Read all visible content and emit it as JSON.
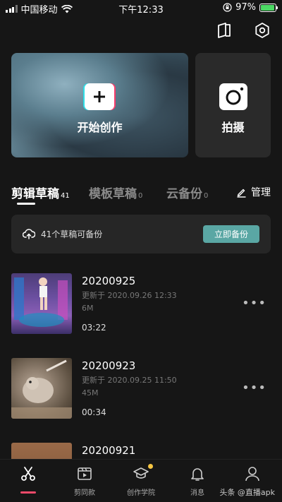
{
  "status_bar": {
    "carrier": "中国移动",
    "time": "下午12:33",
    "battery_percent": "97%",
    "battery_level": 0.97,
    "battery_color": "#4cd964"
  },
  "top_icons": [
    "book-icon",
    "settings-hexagon-icon"
  ],
  "create_card": {
    "label": "开始创作",
    "icon": "plus-icon"
  },
  "shoot_card": {
    "label": "拍摄",
    "icon": "camera-icon"
  },
  "tabs": [
    {
      "label": "剪辑草稿",
      "count": "41",
      "active": true
    },
    {
      "label": "模板草稿",
      "count": "0",
      "active": false
    },
    {
      "label": "云备份",
      "count": "0",
      "active": false
    }
  ],
  "manage": {
    "label": "管理",
    "icon": "edit-icon"
  },
  "backup": {
    "text": "41个草稿可备份",
    "button": "立即备份",
    "button_color": "#5aa7a4"
  },
  "drafts": [
    {
      "title": "20200925",
      "updated": "更新于 2020.09.26 12:33",
      "size": "6M",
      "duration": "03:22"
    },
    {
      "title": "20200923",
      "updated": "更新于 2020.09.25 11:50",
      "size": "45M",
      "duration": "00:34"
    },
    {
      "title": "20200921"
    }
  ],
  "tabbar": [
    {
      "label": "",
      "icon": "scissors-icon",
      "active": true
    },
    {
      "label": "剪同款",
      "icon": "clapper-icon",
      "active": false
    },
    {
      "label": "创作学院",
      "icon": "graduation-cap-icon",
      "active": false,
      "badge": true
    },
    {
      "label": "消息",
      "icon": "bell-icon",
      "active": false
    },
    {
      "label": "我的",
      "icon": "person-icon",
      "active": false
    }
  ],
  "watermark": "头条 @直播apk",
  "accent_color": "#f04a6a"
}
